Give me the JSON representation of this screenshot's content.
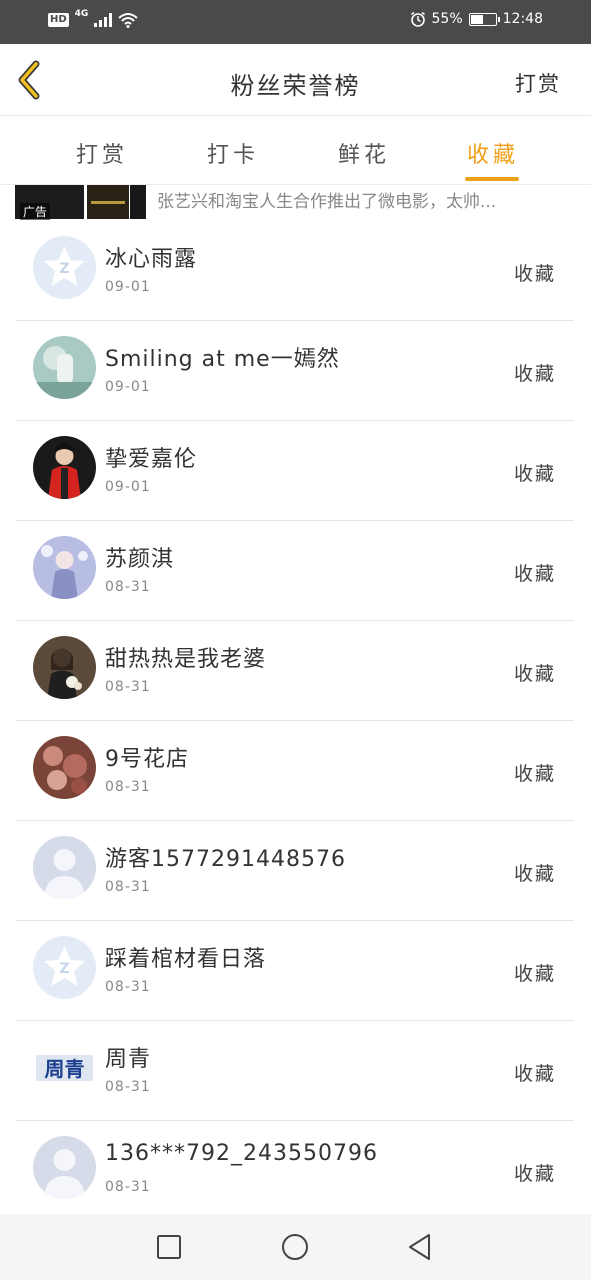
{
  "status_bar": {
    "hd": "HD",
    "network": "4G",
    "battery_text": "55%",
    "battery_level": 0.55,
    "time": "12:48",
    "icons": [
      "hd-badge",
      "signal-icon",
      "wifi-icon",
      "alarm-icon",
      "battery-icon"
    ]
  },
  "header": {
    "back_icon": "chevron-left-icon",
    "title": "粉丝荣誉榜",
    "right_action": "打赏"
  },
  "tabs": [
    {
      "label": "打赏",
      "active": false
    },
    {
      "label": "打卡",
      "active": false
    },
    {
      "label": "鲜花",
      "active": false
    },
    {
      "label": "收藏",
      "active": true
    }
  ],
  "colors": {
    "accent": "#f0a018",
    "text": "#333333",
    "subtext": "#888888",
    "status_bar": "#4a4a4a"
  },
  "ad": {
    "label": "广告",
    "text": "张艺兴和淘宝人生合作推出了微电影，太帅..."
  },
  "list": [
    {
      "name": "冰心雨露",
      "date": "09-01",
      "action": "收藏",
      "avatar": "qq-default-avatar"
    },
    {
      "name": "Smiling at me一嫣然",
      "date": "09-01",
      "action": "收藏",
      "avatar": "photo-avatar"
    },
    {
      "name": "挚爱嘉伦",
      "date": "09-01",
      "action": "收藏",
      "avatar": "photo-avatar"
    },
    {
      "name": "苏颜淇",
      "date": "08-31",
      "action": "收藏",
      "avatar": "photo-avatar"
    },
    {
      "name": "甜热热是我老婆",
      "date": "08-31",
      "action": "收藏",
      "avatar": "photo-avatar"
    },
    {
      "name": "9号花店",
      "date": "08-31",
      "action": "收藏",
      "avatar": "photo-avatar"
    },
    {
      "name": "游客1577291448576",
      "date": "08-31",
      "action": "收藏",
      "avatar": "default-person-avatar"
    },
    {
      "name": "踩着棺材看日落",
      "date": "08-31",
      "action": "收藏",
      "avatar": "qq-default-avatar"
    },
    {
      "name": "周青",
      "date": "08-31",
      "action": "收藏",
      "avatar": "text-avatar",
      "avatar_text": "周青"
    },
    {
      "name": "136***792_243550796",
      "date": "08-31",
      "action": "收藏",
      "avatar": "default-person-avatar"
    }
  ],
  "system_nav": {
    "icons": [
      "recent-apps-icon",
      "home-icon",
      "back-icon"
    ]
  }
}
